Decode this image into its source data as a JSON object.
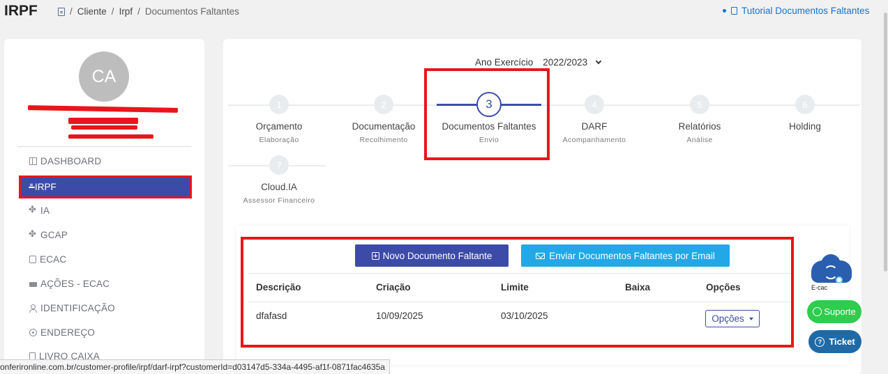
{
  "header": {
    "title": "IRPF",
    "breadcrumb": [
      "Cliente",
      "Irpf",
      "Documentos Faltantes"
    ],
    "breadcrumb_icon": "document-icon",
    "tutorial_link": "Tutorial Documentos Faltantes"
  },
  "sidebar": {
    "avatar_initials": "CA",
    "items": [
      {
        "label": "DASHBOARD",
        "icon": "dashboard-icon"
      },
      {
        "label": "IRPF",
        "icon": "document-icon",
        "active": true
      },
      {
        "label": "IA",
        "icon": "clover-icon"
      },
      {
        "label": "GCAP",
        "icon": "clover-icon"
      },
      {
        "label": "ECAC",
        "icon": "tablet-icon"
      },
      {
        "label": "AÇÕES - ECAC",
        "icon": "money-icon"
      },
      {
        "label": "IDENTIFICAÇÃO",
        "icon": "user-icon"
      },
      {
        "label": "ENDEREÇO",
        "icon": "location-icon"
      },
      {
        "label": "LIVRO CAIXA",
        "icon": "book-icon"
      }
    ]
  },
  "main": {
    "year_label": "Ano Exercício",
    "year_value": "2022/2023",
    "steps": [
      {
        "num": "1",
        "title": "Orçamento",
        "sub": "Elaboração"
      },
      {
        "num": "2",
        "title": "Documentação",
        "sub": "Recolhimento"
      },
      {
        "num": "3",
        "title": "Documentos Faltantes",
        "sub": "Envio",
        "active": true
      },
      {
        "num": "4",
        "title": "DARF",
        "sub": "Acompanhamento"
      },
      {
        "num": "5",
        "title": "Relatórios",
        "sub": "Análise"
      },
      {
        "num": "6",
        "title": "Holding",
        "sub": ""
      },
      {
        "num": "7",
        "title": "Cloud.IA",
        "sub": "Assessor Financeiro"
      }
    ],
    "new_button": "Novo Documento Faltante",
    "email_button": "Enviar Documentos Faltantes por Email",
    "table": {
      "headers": [
        "Descrição",
        "Criação",
        "Limite",
        "Baixa",
        "Opções"
      ],
      "rows": [
        {
          "descricao": "dfafasd",
          "criacao": "10/09/2025",
          "limite": "03/10/2025",
          "baixa": "",
          "opcoes": "Opções"
        }
      ]
    }
  },
  "widgets": {
    "ecac_label": "E-cac",
    "suporte": "Suporte",
    "ticket": "Ticket"
  },
  "status_bar": "onferironline.com.br/customer-profile/irpf/darf-irpf?customerId=d03147d5-334a-4495-af1f-0871fac4635a",
  "colors": {
    "primary": "#3d4ba8",
    "email_button": "#22a8e6",
    "highlight_red": "#e8161b",
    "suporte_green": "#2fcc4e",
    "ticket_blue": "#1f6aa5"
  }
}
